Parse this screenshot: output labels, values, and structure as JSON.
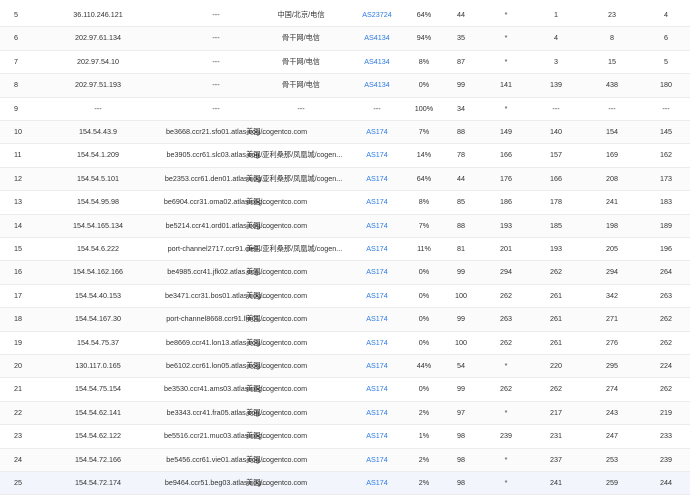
{
  "rows": [
    {
      "hop": "5",
      "ip": "36.110.246.121",
      "host": "---",
      "geo": "中国/北京/电信",
      "asn": "AS23724",
      "loss": "64%",
      "sent": "44",
      "last": "*",
      "avg": "1",
      "best": "23",
      "worst": "4"
    },
    {
      "hop": "6",
      "ip": "202.97.61.134",
      "host": "---",
      "geo": "骨干网/电信",
      "asn": "AS4134",
      "loss": "94%",
      "sent": "35",
      "last": "*",
      "avg": "4",
      "best": "8",
      "worst": "6"
    },
    {
      "hop": "7",
      "ip": "202.97.54.10",
      "host": "---",
      "geo": "骨干网/电信",
      "asn": "AS4134",
      "loss": "8%",
      "sent": "87",
      "last": "*",
      "avg": "3",
      "best": "15",
      "worst": "5"
    },
    {
      "hop": "8",
      "ip": "202.97.51.193",
      "host": "---",
      "geo": "骨干网/电信",
      "asn": "AS4134",
      "loss": "0%",
      "sent": "99",
      "last": "141",
      "avg": "139",
      "best": "438",
      "worst": "180"
    },
    {
      "hop": "9",
      "ip": "---",
      "host": "---",
      "geo": "---",
      "asn": "---",
      "loss": "100%",
      "sent": "34",
      "last": "*",
      "avg": "---",
      "best": "---",
      "worst": "---"
    },
    {
      "hop": "10",
      "ip": "154.54.43.9",
      "host": "be3668.ccr21.sfo01.atlas.cog...",
      "geo": "美国/cogentco.com",
      "asn": "AS174",
      "loss": "7%",
      "sent": "88",
      "last": "149",
      "avg": "140",
      "best": "154",
      "worst": "145"
    },
    {
      "hop": "11",
      "ip": "154.54.1.209",
      "host": "be3905.ccr61.slc03.atlas.cog...",
      "geo": "美国/亚利桑那/凤凰城/cogen...",
      "asn": "AS174",
      "loss": "14%",
      "sent": "78",
      "last": "166",
      "avg": "157",
      "best": "169",
      "worst": "162"
    },
    {
      "hop": "12",
      "ip": "154.54.5.101",
      "host": "be2353.ccr61.den01.atlas.cog...",
      "geo": "美国/亚利桑那/凤凰城/cogen...",
      "asn": "AS174",
      "loss": "64%",
      "sent": "44",
      "last": "176",
      "avg": "166",
      "best": "208",
      "worst": "173"
    },
    {
      "hop": "13",
      "ip": "154.54.95.98",
      "host": "be6904.ccr31.oma02.atlas.cog...",
      "geo": "美国/cogentco.com",
      "asn": "AS174",
      "loss": "8%",
      "sent": "85",
      "last": "186",
      "avg": "178",
      "best": "241",
      "worst": "183"
    },
    {
      "hop": "14",
      "ip": "154.54.165.134",
      "host": "be5214.ccr41.ord01.atlas.cog...",
      "geo": "美国/cogentco.com",
      "asn": "AS174",
      "loss": "7%",
      "sent": "88",
      "last": "193",
      "avg": "185",
      "best": "198",
      "worst": "189"
    },
    {
      "hop": "15",
      "ip": "154.54.6.222",
      "host": "port-channel2717.ccr91.cle0...",
      "geo": "美国/亚利桑那/凤凰城/cogen...",
      "asn": "AS174",
      "loss": "11%",
      "sent": "81",
      "last": "201",
      "avg": "193",
      "best": "205",
      "worst": "196"
    },
    {
      "hop": "16",
      "ip": "154.54.162.166",
      "host": "be4985.ccr41.jfk02.atlas.cog...",
      "geo": "美国/cogentco.com",
      "asn": "AS174",
      "loss": "0%",
      "sent": "99",
      "last": "294",
      "avg": "262",
      "best": "294",
      "worst": "264"
    },
    {
      "hop": "17",
      "ip": "154.54.40.153",
      "host": "be3471.ccr31.bos01.atlas.cog...",
      "geo": "美国/cogentco.com",
      "asn": "AS174",
      "loss": "0%",
      "sent": "100",
      "last": "262",
      "avg": "261",
      "best": "342",
      "worst": "263"
    },
    {
      "hop": "18",
      "ip": "154.54.167.30",
      "host": "port-channel8668.ccr91.lhr01...",
      "geo": "美国/cogentco.com",
      "asn": "AS174",
      "loss": "0%",
      "sent": "99",
      "last": "263",
      "avg": "261",
      "best": "271",
      "worst": "262"
    },
    {
      "hop": "19",
      "ip": "154.54.75.37",
      "host": "be8669.ccr41.lon13.atlas.cog...",
      "geo": "美国/cogentco.com",
      "asn": "AS174",
      "loss": "0%",
      "sent": "100",
      "last": "262",
      "avg": "261",
      "best": "276",
      "worst": "262"
    },
    {
      "hop": "20",
      "ip": "130.117.0.165",
      "host": "be6102.ccr61.lon05.atlas.cog...",
      "geo": "美国/cogentco.com",
      "asn": "AS174",
      "loss": "44%",
      "sent": "54",
      "last": "*",
      "avg": "220",
      "best": "295",
      "worst": "224"
    },
    {
      "hop": "21",
      "ip": "154.54.75.154",
      "host": "be3530.ccr41.ams03.atlas.cog...",
      "geo": "美国/cogentco.com",
      "asn": "AS174",
      "loss": "0%",
      "sent": "99",
      "last": "262",
      "avg": "262",
      "best": "274",
      "worst": "262"
    },
    {
      "hop": "22",
      "ip": "154.54.62.141",
      "host": "be3343.ccr41.fra05.atlas.cog...",
      "geo": "美国/cogentco.com",
      "asn": "AS174",
      "loss": "2%",
      "sent": "97",
      "last": "*",
      "avg": "217",
      "best": "243",
      "worst": "219"
    },
    {
      "hop": "23",
      "ip": "154.54.62.122",
      "host": "be5516.ccr21.muc03.atlas.cog...",
      "geo": "美国/cogentco.com",
      "asn": "AS174",
      "loss": "1%",
      "sent": "98",
      "last": "239",
      "avg": "231",
      "best": "247",
      "worst": "233"
    },
    {
      "hop": "24",
      "ip": "154.54.72.166",
      "host": "be5456.ccr61.vie01.atlas.cog...",
      "geo": "美国/cogentco.com",
      "asn": "AS174",
      "loss": "2%",
      "sent": "98",
      "last": "*",
      "avg": "237",
      "best": "253",
      "worst": "239"
    },
    {
      "hop": "25",
      "ip": "154.54.72.174",
      "host": "be9464.ccr51.beg03.atlas.cog...",
      "geo": "美国/cogentco.com",
      "asn": "AS174",
      "loss": "2%",
      "sent": "98",
      "last": "*",
      "avg": "241",
      "best": "259",
      "worst": "244"
    }
  ],
  "colors": {
    "asn_link": "#2d7be5",
    "row_border": "#ececec",
    "highlight_row": "#f2f6fc"
  }
}
